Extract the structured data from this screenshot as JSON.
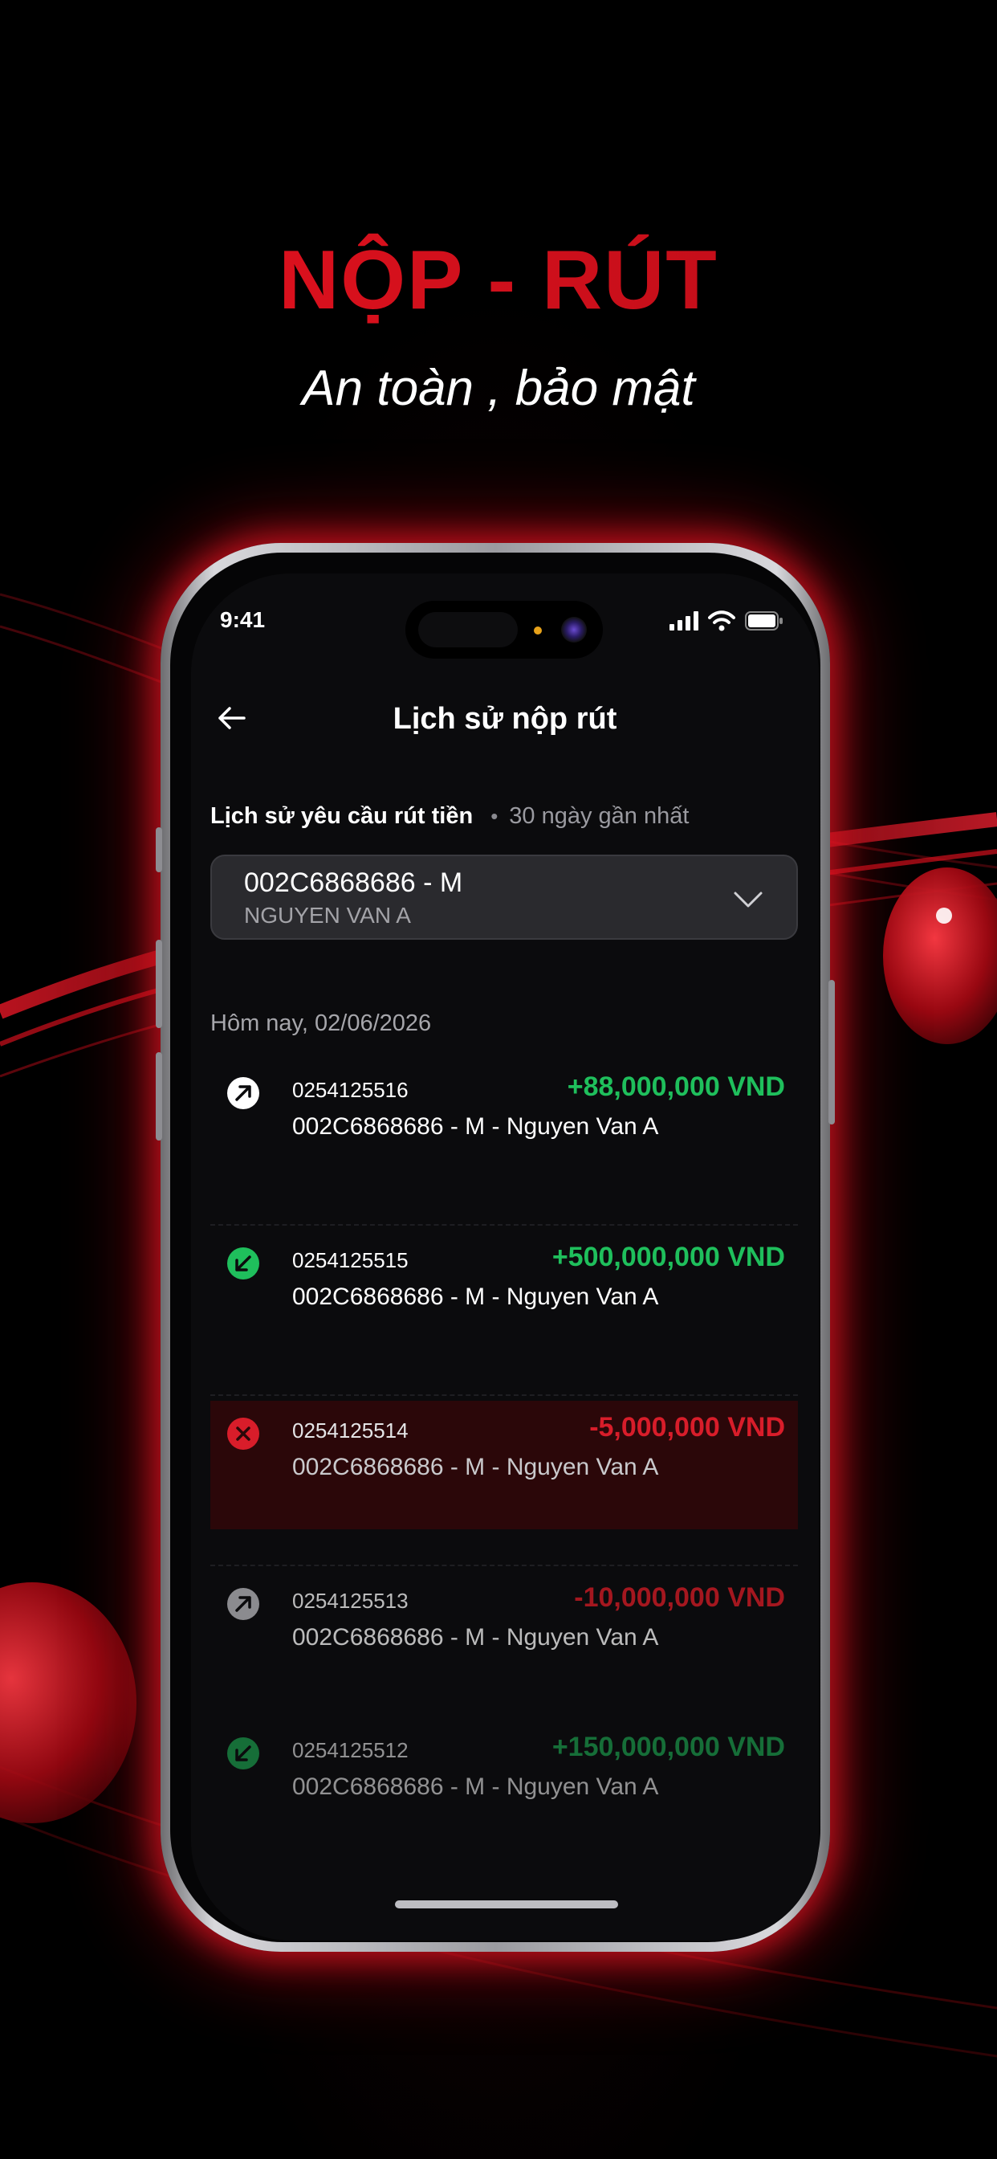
{
  "promo": {
    "headline": "NỘP - RÚT",
    "subheadline": "An toàn , bảo mật"
  },
  "status_bar": {
    "time": "9:41"
  },
  "screen": {
    "title": "Lịch sử nộp rút",
    "section_title": "Lịch sử yêu cầu rút tiền",
    "section_filter": "30 ngày gần nhất",
    "account": {
      "id": "002C6868686 - M",
      "name": "NGUYEN VAN A"
    },
    "date_group": "Hôm nay, 02/06/2026",
    "transactions": [
      {
        "code": "0254125516",
        "amount": "+88,000,000 VND",
        "description": "002C6868686 - M - Nguyen Van A",
        "status": "withdraw",
        "icon": "arrow-up-right-icon",
        "color": "#1fbf5c"
      },
      {
        "code": "0254125515",
        "amount": "+500,000,000 VND",
        "description": "002C6868686 - M - Nguyen Van A",
        "status": "deposit",
        "icon": "arrow-down-left-icon",
        "color": "#1fbf5c"
      },
      {
        "code": "0254125514",
        "amount": "-5,000,000 VND",
        "description": "002C6868686 - M - Nguyen Van A",
        "status": "failed",
        "icon": "close-icon",
        "color": "#d81d2a"
      },
      {
        "code": "0254125513",
        "amount": "-10,000,000 VND",
        "description": "002C6868686 - M - Nguyen Van A",
        "status": "withdraw",
        "icon": "arrow-up-right-icon",
        "color": "#c81a24"
      },
      {
        "code": "0254125512",
        "amount": "+150,000,000 VND",
        "description": "002C6868686 - M - Nguyen Van A",
        "status": "deposit",
        "icon": "arrow-down-left-icon",
        "color": "#1a9c4a"
      }
    ]
  },
  "colors": {
    "brand_red": "#e0121f",
    "positive_green": "#1fbf5c",
    "negative_red": "#d81d2a",
    "failed_row_bg": "#2b0709"
  }
}
